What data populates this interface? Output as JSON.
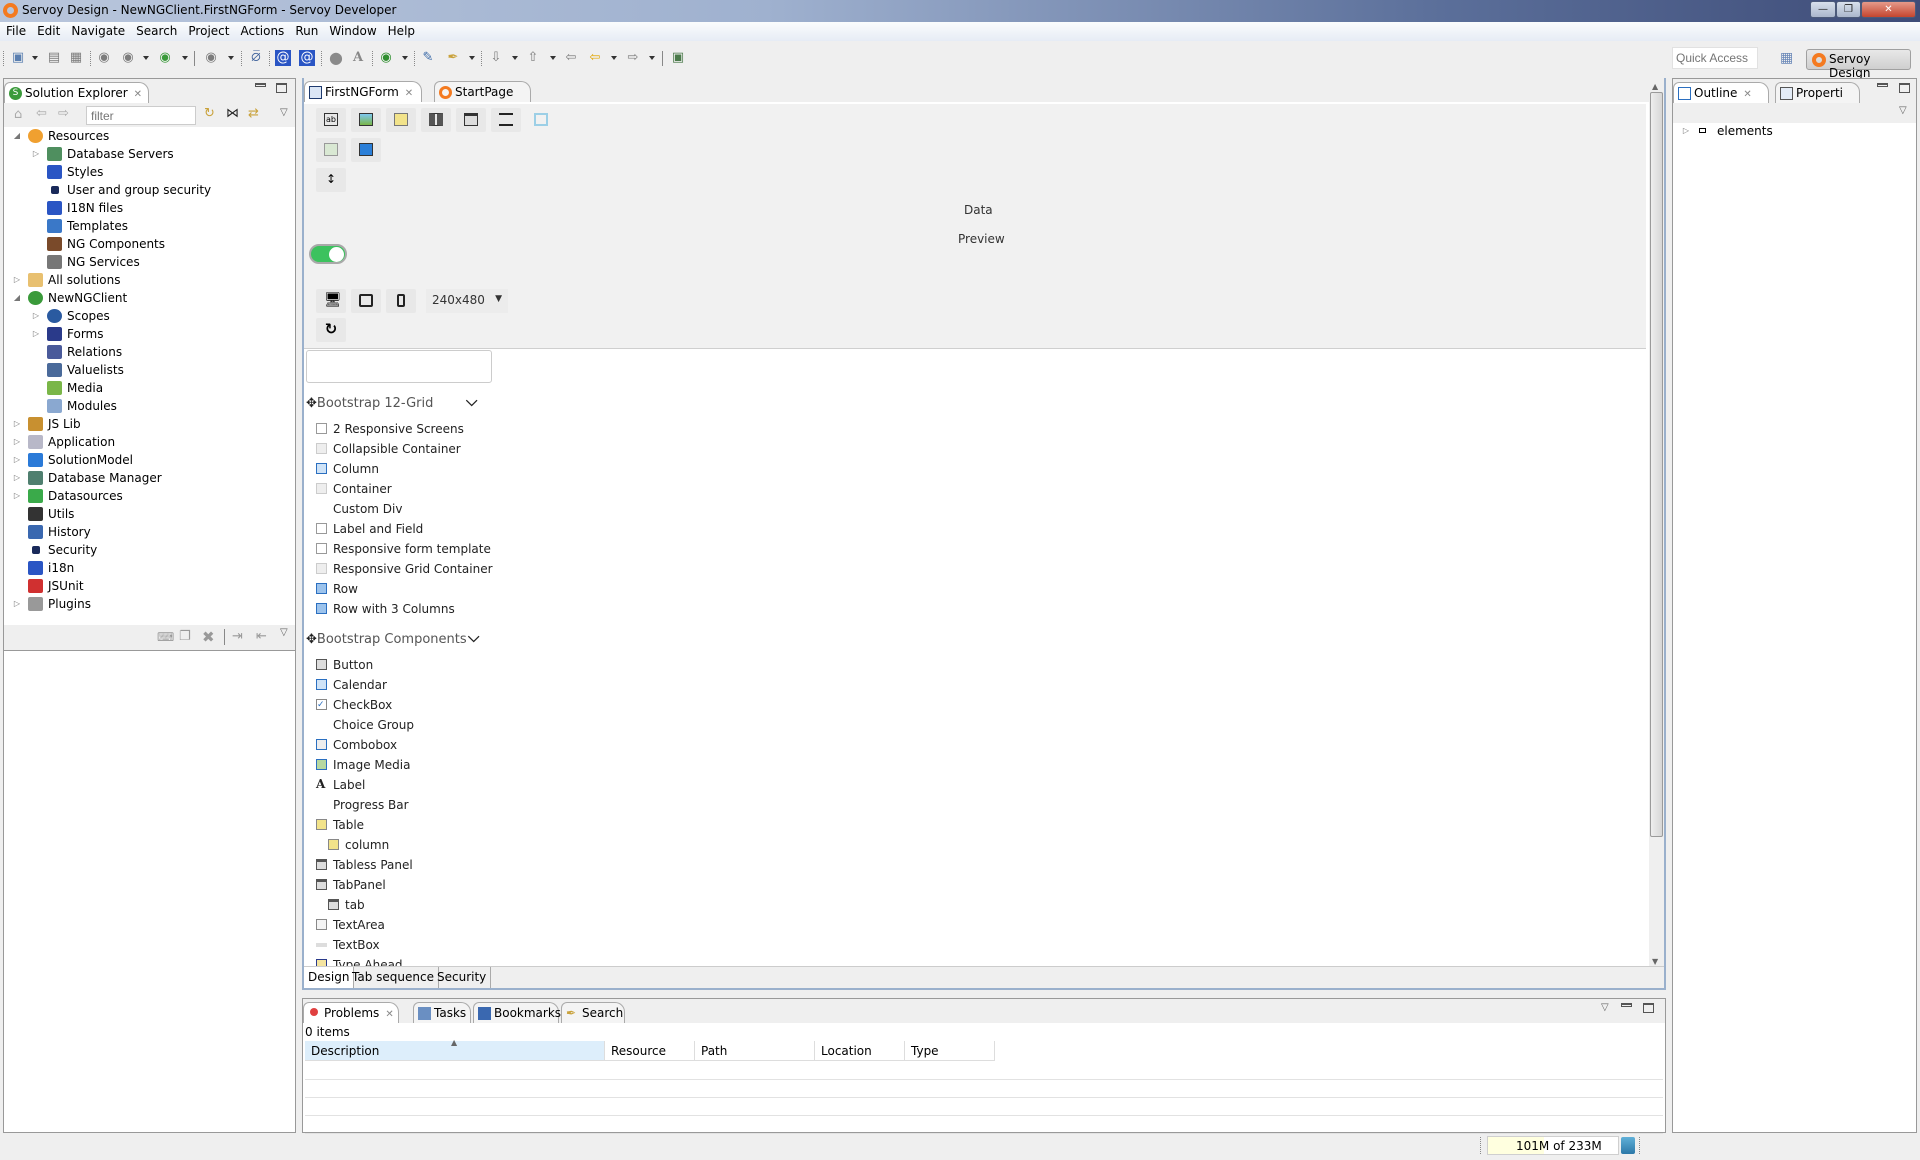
{
  "window": {
    "title": "Servoy Design - NewNGClient.FirstNGForm - Servoy Developer",
    "controls": [
      "minimize",
      "restore",
      "close"
    ]
  },
  "menubar": {
    "items": [
      "File",
      "Edit",
      "Navigate",
      "Search",
      "Project",
      "Actions",
      "Run",
      "Window",
      "Help"
    ]
  },
  "toolbar": {
    "quick_access_placeholder": "Quick Access",
    "perspective_label": "Servoy Design",
    "icons": [
      "new-icon",
      "save-icon",
      "save-all-icon",
      "debug-smart-client-icon",
      "debug-web-client-icon",
      "debug-ng-client-icon",
      "debug-mobile-icon",
      "no-debug-icon",
      "i18n-flag-icon",
      "i18n-icon",
      "circle-icon",
      "font-icon",
      "run-tests-icon",
      "script-icon",
      "pen-icon",
      "next-annotation-icon",
      "previous-annotation-icon",
      "back-icon",
      "back-nav-icon",
      "forward-nav-icon",
      "open-perspective-icon"
    ]
  },
  "solution_explorer": {
    "tab_label": "Solution Explorer",
    "filter_placeholder": "filter",
    "tree": [
      {
        "label": "Resources",
        "level": 0,
        "expanded": true,
        "icon": "resources-icon"
      },
      {
        "label": "Database Servers",
        "level": 1,
        "expandable": true,
        "icon": "database-servers-icon"
      },
      {
        "label": "Styles",
        "level": 1,
        "icon": "styles-icon"
      },
      {
        "label": "User and group security",
        "level": 1,
        "icon": "lock-icon"
      },
      {
        "label": "I18N files",
        "level": 1,
        "icon": "i18n-flag-icon"
      },
      {
        "label": "Templates",
        "level": 1,
        "icon": "templates-icon"
      },
      {
        "label": "NG Components",
        "level": 1,
        "icon": "ng-components-icon"
      },
      {
        "label": "NG Services",
        "level": 1,
        "icon": "ng-services-icon"
      },
      {
        "label": "All solutions",
        "level": 0,
        "expandable": true,
        "icon": "folder-icon"
      },
      {
        "label": "NewNGClient",
        "level": 0,
        "expanded": true,
        "icon": "solution-icon"
      },
      {
        "label": "Scopes",
        "level": 1,
        "expandable": true,
        "icon": "scopes-icon"
      },
      {
        "label": "Forms",
        "level": 1,
        "expandable": true,
        "icon": "forms-icon"
      },
      {
        "label": "Relations",
        "level": 1,
        "icon": "relations-icon"
      },
      {
        "label": "Valuelists",
        "level": 1,
        "icon": "valuelists-icon"
      },
      {
        "label": "Media",
        "level": 1,
        "icon": "media-icon"
      },
      {
        "label": "Modules",
        "level": 1,
        "icon": "modules-icon"
      },
      {
        "label": "JS Lib",
        "level": 0,
        "expandable": true,
        "icon": "js-lib-icon"
      },
      {
        "label": "Application",
        "level": 0,
        "expandable": true,
        "icon": "application-icon"
      },
      {
        "label": "SolutionModel",
        "level": 0,
        "expandable": true,
        "icon": "solution-model-icon"
      },
      {
        "label": "Database Manager",
        "level": 0,
        "expandable": true,
        "icon": "database-manager-icon"
      },
      {
        "label": "Datasources",
        "level": 0,
        "expandable": true,
        "icon": "datasources-icon"
      },
      {
        "label": "Utils",
        "level": 0,
        "icon": "utils-icon"
      },
      {
        "label": "History",
        "level": 0,
        "icon": "history-icon"
      },
      {
        "label": "Security",
        "level": 0,
        "icon": "lock-icon"
      },
      {
        "label": "i18n",
        "level": 0,
        "icon": "i18n-flag-icon"
      },
      {
        "label": "JSUnit",
        "level": 0,
        "icon": "jsunit-icon"
      },
      {
        "label": "Plugins",
        "level": 0,
        "expandable": true,
        "icon": "plugins-icon"
      }
    ]
  },
  "editor": {
    "tabs": [
      {
        "label": "FirstNGForm",
        "active": true,
        "closable": true
      },
      {
        "label": "StartPage",
        "active": false
      }
    ],
    "data_label": "Data",
    "preview_label": "Preview",
    "device_size": "240x480",
    "palette": {
      "sections": [
        {
          "title": "Bootstrap 12-Grid",
          "items": [
            {
              "label": "2 Responsive Screens",
              "icon": "blank-box-icon"
            },
            {
              "label": "Collapsible Container",
              "icon": "grid-icon"
            },
            {
              "label": "Column",
              "icon": "column-icon"
            },
            {
              "label": "Container",
              "icon": "grid-icon"
            },
            {
              "label": "Custom Div",
              "icon": ""
            },
            {
              "label": "Label and Field",
              "icon": "blank-box-icon"
            },
            {
              "label": "Responsive form template",
              "icon": "blank-box-icon"
            },
            {
              "label": "Responsive Grid Container",
              "icon": "grid-icon"
            },
            {
              "label": "Row",
              "icon": "row-icon"
            },
            {
              "label": "Row with 3 Columns",
              "icon": "row-icon"
            }
          ]
        },
        {
          "title": "Bootstrap Components",
          "items": [
            {
              "label": "Button",
              "icon": "button-icon"
            },
            {
              "label": "Calendar",
              "icon": "calendar-icon"
            },
            {
              "label": "CheckBox",
              "icon": "checkbox-icon"
            },
            {
              "label": "Choice Group",
              "icon": ""
            },
            {
              "label": "Combobox",
              "icon": "combobox-icon"
            },
            {
              "label": "Image Media",
              "icon": "image-media-icon"
            },
            {
              "label": "Label",
              "icon": "label-icon"
            },
            {
              "label": "Progress Bar",
              "icon": ""
            },
            {
              "label": "Table",
              "icon": "table-icon"
            },
            {
              "label": "column",
              "icon": "table-icon",
              "indent": true
            },
            {
              "label": "Tabless Panel",
              "icon": "tab-panel-icon"
            },
            {
              "label": "TabPanel",
              "icon": "tab-panel-icon"
            },
            {
              "label": "tab",
              "icon": "tab-panel-icon",
              "indent": true
            },
            {
              "label": "TextArea",
              "icon": "textarea-icon"
            },
            {
              "label": "TextBox",
              "icon": "textbox-icon"
            },
            {
              "label": "Type Ahead",
              "icon": "typeahead-icon"
            }
          ]
        }
      ]
    },
    "bottom_tabs": [
      "Design",
      "Tab sequence",
      "Security"
    ]
  },
  "problems": {
    "tabs": [
      "Problems",
      "Tasks",
      "Bookmarks",
      "Search"
    ],
    "count_text": "0 items",
    "columns": [
      "Description",
      "Resource",
      "Path",
      "Location",
      "Type"
    ],
    "rows": []
  },
  "outline": {
    "tabs": [
      "Outline",
      "Properti"
    ],
    "tree": [
      {
        "label": "elements",
        "expandable": true
      }
    ]
  },
  "status": {
    "heap_text": "101M of 233M",
    "heap_used_fraction": 0.43
  },
  "colors": {
    "accent_orange": "#f47a20",
    "toggle_green": "#3cc25e",
    "editor_border": "#9ab0cc"
  }
}
